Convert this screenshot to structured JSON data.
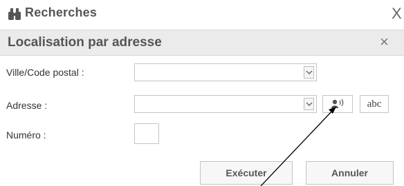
{
  "top_bar": {
    "title": "Recherches",
    "close_glyph": "X",
    "icon": "binoculars-icon"
  },
  "panel": {
    "title": "Localisation par adresse",
    "close_glyph": "×"
  },
  "form": {
    "city": {
      "label": "Ville/Code postal :",
      "value": "",
      "arrow_icon": "chevron-down-icon"
    },
    "address": {
      "label": "Adresse :",
      "value": "",
      "arrow_icon": "chevron-down-icon",
      "voice_icon": "voice-input-icon",
      "keyboard_label": "abc"
    },
    "number": {
      "label": "Numéro :",
      "value": ""
    }
  },
  "actions": {
    "execute_label": "Exécuter",
    "cancel_label": "Annuler"
  },
  "annotation": {
    "arrow": "pointer-arrow"
  }
}
